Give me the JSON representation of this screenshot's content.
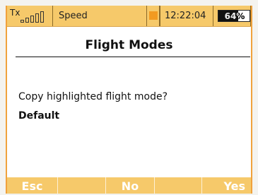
{
  "status_bar": {
    "tx_label": "Tx",
    "signal_bars": 5,
    "signal_icon": "signal-bars-icon",
    "profile": "Speed",
    "indicator_color": "#f29a21",
    "time": "12:22:04",
    "battery_percent_text": "64%",
    "battery_level": 0.64
  },
  "dialog": {
    "title": "Flight Modes",
    "question": "Copy highlighted flight mode?",
    "mode_name": "Default"
  },
  "softkeys": [
    "Esc",
    "",
    "No",
    "",
    "Yes"
  ],
  "colors": {
    "bar": "#f6c96a",
    "accent": "#f0a23c",
    "softkey_text": "#ffffff"
  }
}
